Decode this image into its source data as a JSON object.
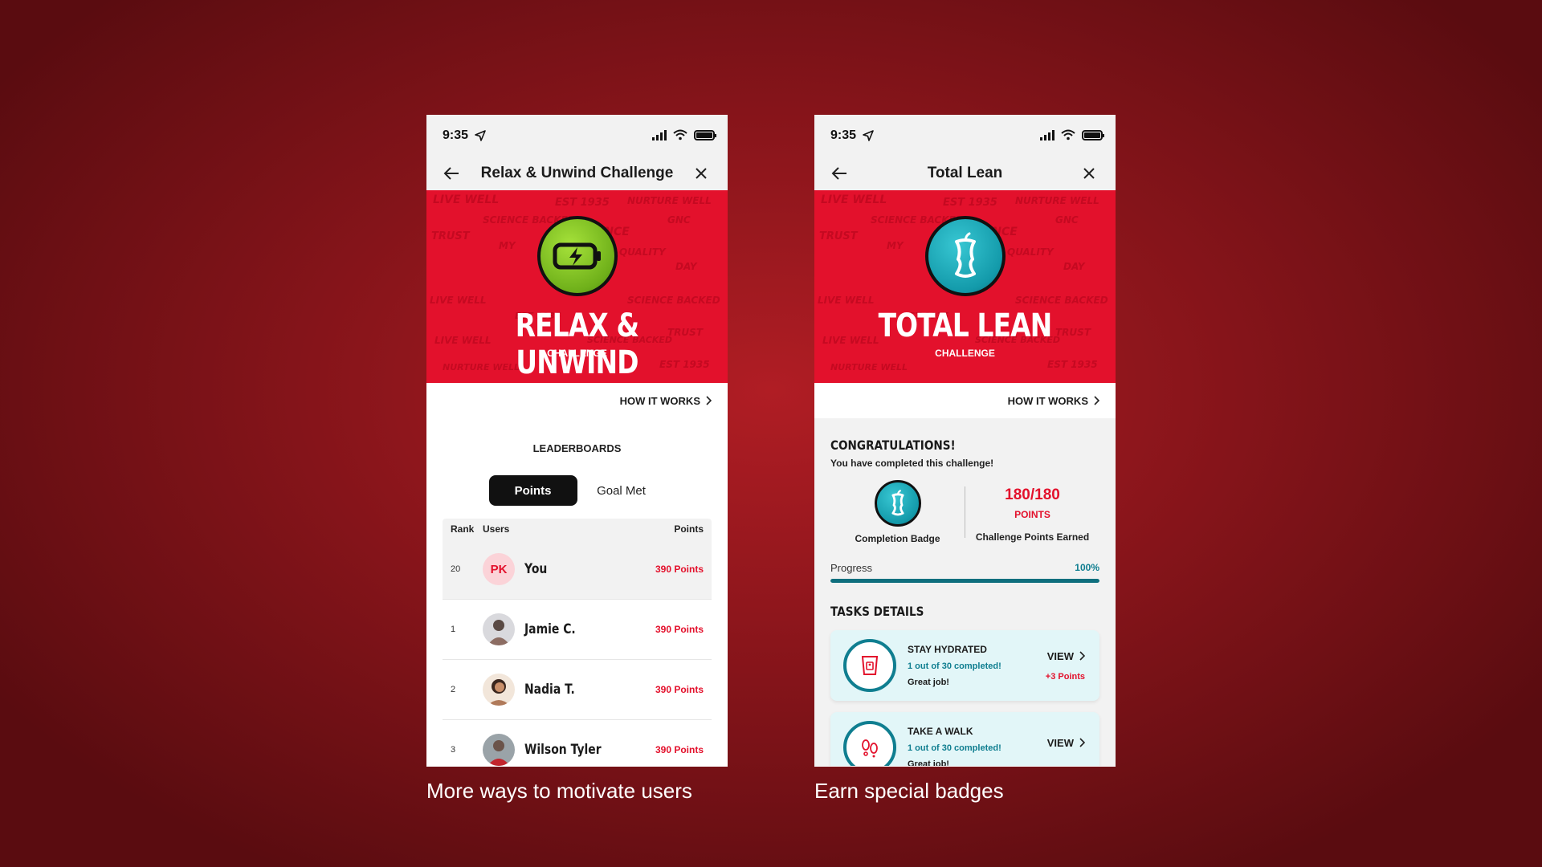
{
  "left": {
    "status_time": "9:35",
    "header_title": "Relax & Unwind Challenge",
    "banner_title": "RELAX & UNWIND",
    "banner_sub": "CHALLENGE",
    "badge_icon": "battery-bolt-icon",
    "how_it_works": "HOW IT WORKS",
    "leaderboards_title": "LEADERBOARDS",
    "tabs": [
      "Points",
      "Goal Met"
    ],
    "columns": [
      "Rank",
      "Users",
      "Points"
    ],
    "rows": [
      {
        "rank": "20",
        "initials": "PK",
        "name": "You",
        "points": "390 Points"
      },
      {
        "rank": "1",
        "name": "Jamie C.",
        "points": "390 Points"
      },
      {
        "rank": "2",
        "name": "Nadia T.",
        "points": "390 Points"
      },
      {
        "rank": "3",
        "name": "Wilson Tyler",
        "points": "390 Points"
      }
    ],
    "caption": "More ways to motivate users"
  },
  "right": {
    "status_time": "9:35",
    "header_title": "Total Lean",
    "banner_title": "TOTAL LEAN",
    "banner_sub": "CHALLENGE",
    "badge_icon": "apple-core-icon",
    "how_it_works": "HOW IT WORKS",
    "congrats_title": "CONGRATULATIONS!",
    "congrats_sub": "You have completed this challenge!",
    "completion_badge_label": "Completion Badge",
    "score": "180/180",
    "score_unit": "POINTS",
    "score_label": "Challenge Points Earned",
    "progress_label": "Progress",
    "progress_pct_text": "100%",
    "progress_fraction": 1.0,
    "tasks_title": "TASKS DETAILS",
    "tasks": [
      {
        "name": "STAY HYDRATED",
        "progress": "1 out of 30 completed!",
        "note": "Great job!",
        "view": "VIEW",
        "bonus": "+3 Points",
        "icon": "cup-icon"
      },
      {
        "name": "TAKE A WALK",
        "progress": "1 out of 30 completed!",
        "note": "Great job!",
        "view": "VIEW",
        "bonus": "",
        "icon": "footprints-icon"
      }
    ],
    "caption": "Earn special badges"
  },
  "pattern_words": [
    "LIVE WELL",
    "SCIENCE BACKED",
    "EST 1935",
    "NURTURE WELL",
    "GNC",
    "TRUST",
    "MY",
    "BALANCE",
    "QUALITY",
    "DAY",
    "LIVE WELL",
    "EST 1935",
    "SCIENCE BACKED",
    "TRUST"
  ],
  "colors": {
    "brand_red": "#e3112c",
    "teal": "#0f7e90",
    "green": "#7cc41d"
  }
}
